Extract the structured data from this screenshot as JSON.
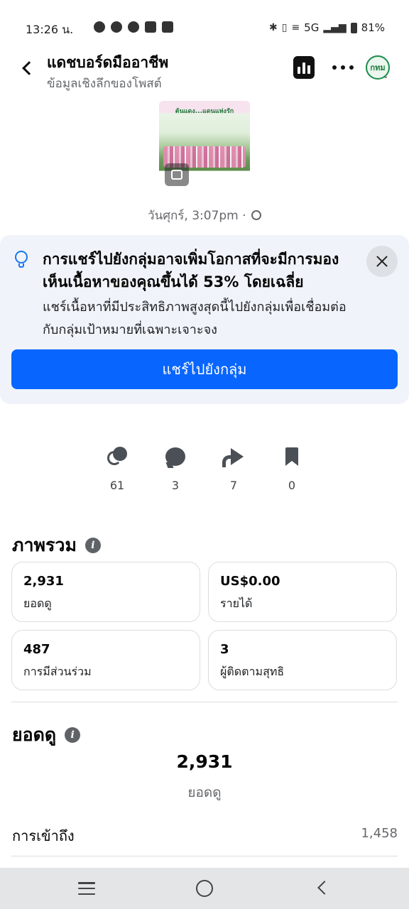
{
  "status_bar": {
    "time": "13:26 น.",
    "network": "5G",
    "battery": "81%"
  },
  "header": {
    "title": "แดชบอร์ดมืออาชีพ",
    "subtitle": "ข้อมูลเชิงลึกของโพสต์",
    "avatar_text": "กทม"
  },
  "post": {
    "thumbnail_caption": "ต้นแดง...แดนแห่งรัก",
    "date": "วันศุกร์, 3:07pm ·"
  },
  "tip": {
    "title": "การแชร์ไปยังกลุ่มอาจเพิ่มโอกาสที่จะมีการมองเห็นเนื้อหาของคุณขึ้นได้ 53% โดยเฉลี่ย",
    "body": "แชร์เนื้อหาที่มีประสิทธิภาพสูงสุดนี้ไปยังกลุ่มเพื่อเชื่อมต่อกับกลุ่มเป้าหมายที่เฉพาะเจาะจง",
    "button_label": "แชร์ไปยังกลุ่ม"
  },
  "engagement": {
    "reactions": "61",
    "comments": "3",
    "shares": "7",
    "saves": "0"
  },
  "overview": {
    "title": "ภาพรวม",
    "cards": [
      {
        "value": "2,931",
        "label": "ยอดดู"
      },
      {
        "value": "US$0.00",
        "label": "รายได้"
      },
      {
        "value": "487",
        "label": "การมีส่วนร่วม"
      },
      {
        "value": "3",
        "label": "ผู้ติดตามสุทธิ"
      }
    ]
  },
  "views": {
    "title": "ยอดดู",
    "total": "2,931",
    "total_label": "ยอดดู",
    "reach_label": "การเข้าถึง",
    "reach_value": "1,458"
  }
}
